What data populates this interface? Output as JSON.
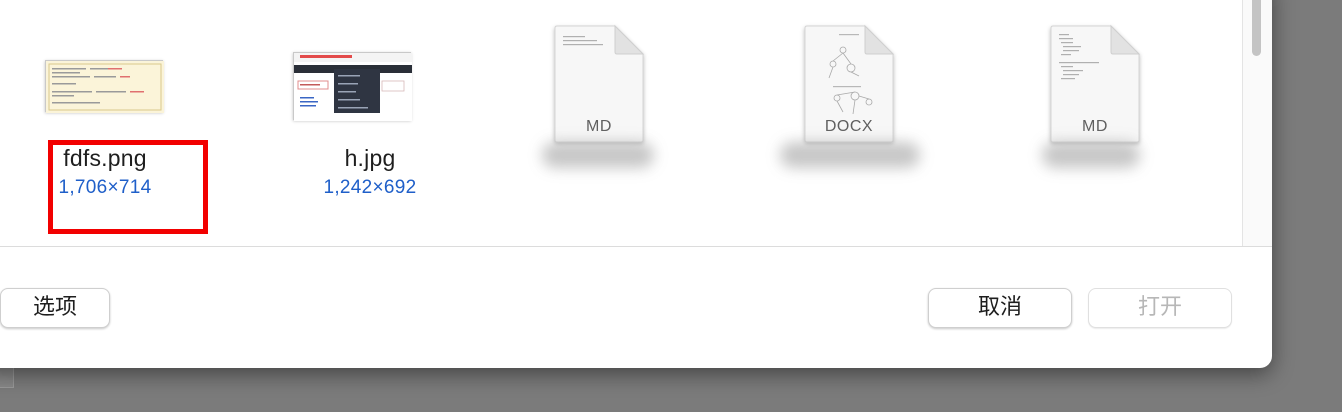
{
  "files": [
    {
      "name": "fdfs.png",
      "dims": "1,706×714"
    },
    {
      "name": "h.jpg",
      "dims": "1,242×692"
    }
  ],
  "documents": [
    {
      "type": "MD"
    },
    {
      "type": "DOCX"
    },
    {
      "type": "MD"
    }
  ],
  "buttons": {
    "options": "选项",
    "cancel": "取消",
    "open": "打开"
  },
  "colors": {
    "highlight": "#f20000",
    "dims_text": "#1f5fc9",
    "disabled_text": "#b7b7b7"
  }
}
